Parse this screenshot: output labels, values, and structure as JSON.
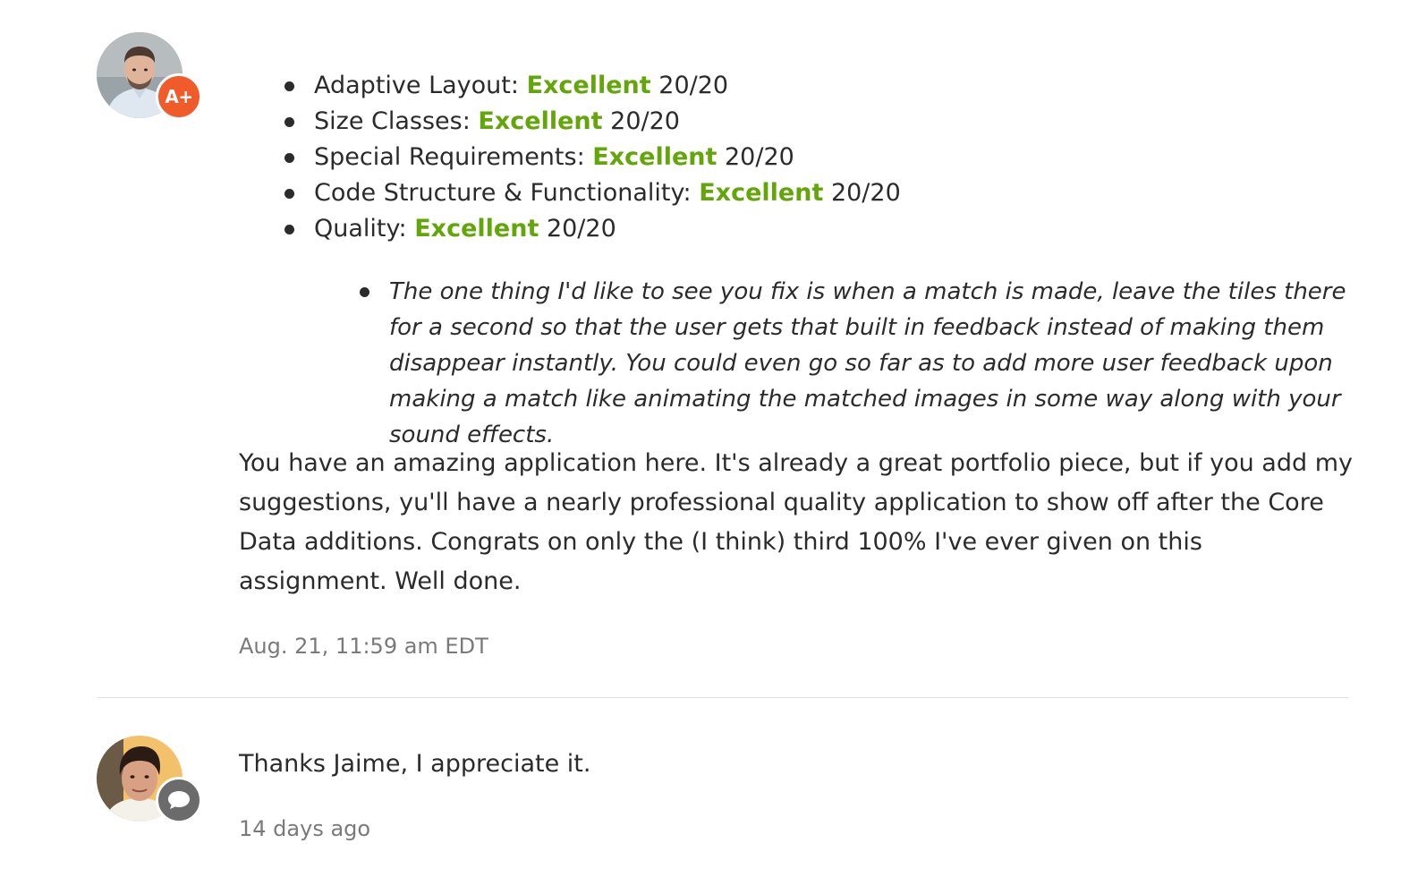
{
  "review": {
    "author_badge": "A+",
    "rubric": [
      {
        "label": "Adaptive Layout:",
        "rating": "Excellent",
        "score": "20/20"
      },
      {
        "label": "Size Classes:",
        "rating": "Excellent",
        "score": "20/20"
      },
      {
        "label": "Special Requirements:",
        "rating": "Excellent",
        "score": "20/20"
      },
      {
        "label": "Code Structure & Functionality:",
        "rating": "Excellent",
        "score": "20/20"
      },
      {
        "label": "Quality:",
        "rating": "Excellent",
        "score": "20/20"
      }
    ],
    "note": "The one thing I'd like to see you fix is when a match is made, leave the tiles there for a second so that the user gets that built in feedback instead of making them disappear instantly. You could even go so far as to add more user feedback upon making a match like animating the matched images in some way along with your sound effects.",
    "body": "You have an amazing application here. It's already a great portfolio piece, but if you add my suggestions, yu'll have a nearly professional quality application to show off after the Core Data additions. Congrats on only the (I think) third 100% I've ever given on this assignment. Well done.",
    "timestamp": "Aug. 21, 11:59 am EDT",
    "avatar_icon": "reviewer-avatar",
    "badge_color": "#f15a29"
  },
  "reply": {
    "text": "Thanks Jaime, I appreciate it.",
    "timestamp": "14 days ago",
    "avatar_icon": "student-avatar",
    "badge_icon": "speech-bubble-icon",
    "badge_color": "#6b6b6b"
  },
  "colors": {
    "accent_green": "#62a60a",
    "text": "#2b2b2b",
    "muted": "#7a7a7a"
  }
}
